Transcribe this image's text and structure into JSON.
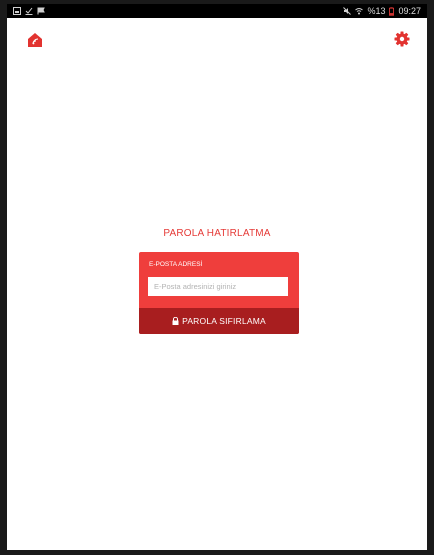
{
  "statusbar": {
    "left_icons": [
      "gallery-icon",
      "download-check-icon",
      "flag-icon"
    ],
    "right_icons": [
      "mute-icon",
      "wifi-icon",
      "battery-icon"
    ],
    "battery_text": "%13",
    "time": "09:27"
  },
  "header": {
    "logo_icon": "home-signal-icon",
    "settings_icon": "gear-icon"
  },
  "page": {
    "title": "PAROLA HATIRLATMA"
  },
  "form": {
    "email_label": "E-POSTA ADRESİ",
    "email_placeholder": "E-Posta adresinizi giriniz",
    "email_value": "",
    "submit_label": "PAROLA SIFIRLAMA",
    "submit_icon": "lock-icon"
  },
  "colors": {
    "accent": "#ef3e3c",
    "accent_dark": "#a81e1f",
    "title": "#e53a37"
  }
}
